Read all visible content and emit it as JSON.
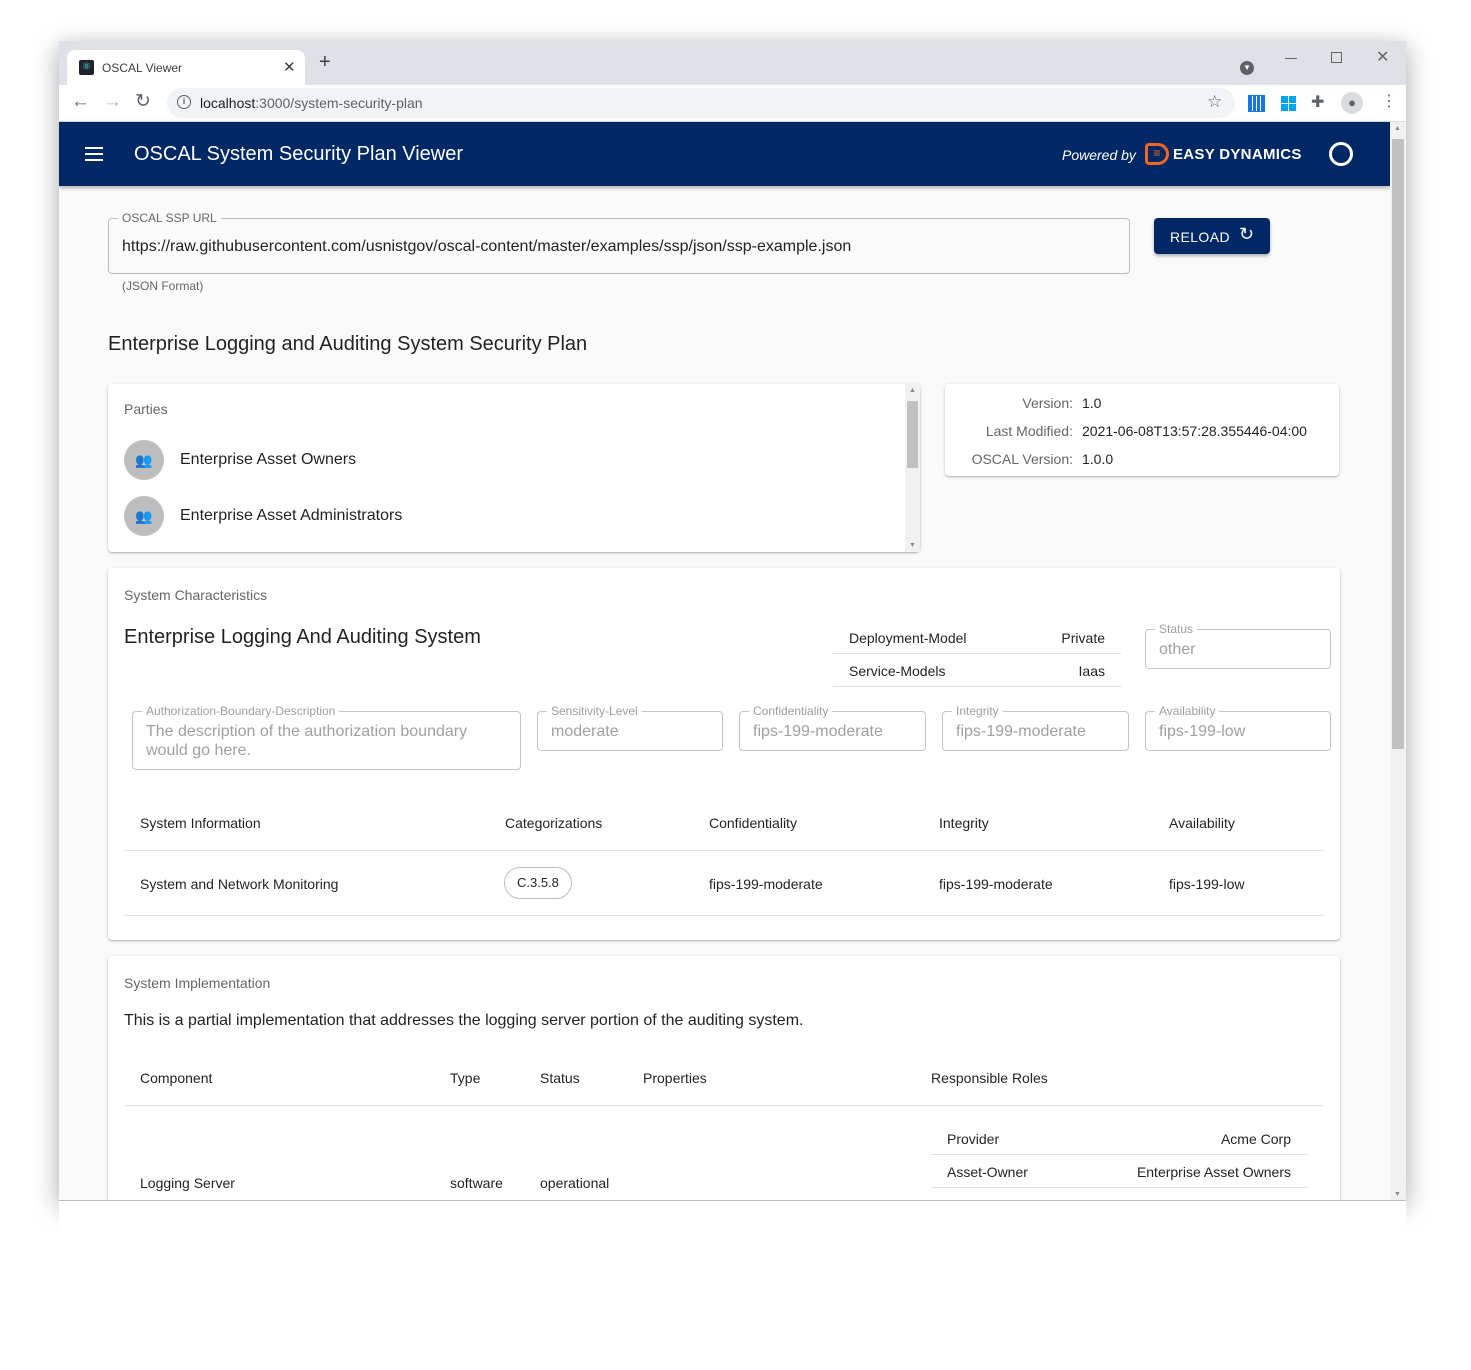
{
  "browser": {
    "tab_title": "OSCAL Viewer",
    "url_host": "localhost",
    "url_path": ":3000/system-security-plan"
  },
  "app": {
    "title": "OSCAL System Security Plan Viewer",
    "powered_by": "Powered by",
    "brand": "EASY DYNAMICS",
    "brand_color": "#f26722",
    "header_color": "#002864"
  },
  "url_field": {
    "label": "OSCAL SSP URL",
    "value": "https://raw.githubusercontent.com/usnistgov/oscal-content/master/examples/ssp/json/ssp-example.json",
    "helper": "(JSON Format)",
    "reload_label": "RELOAD"
  },
  "ssp_title": "Enterprise Logging and Auditing System Security Plan",
  "parties": {
    "heading": "Parties",
    "items": [
      "Enterprise Asset Owners",
      "Enterprise Asset Administrators"
    ]
  },
  "metadata": {
    "version_label": "Version:",
    "version": "1.0",
    "modified_label": "Last Modified:",
    "modified": "2021-06-08T13:57:28.355446-04:00",
    "oscal_label": "OSCAL Version:",
    "oscal": "1.0.0"
  },
  "characteristics": {
    "heading": "System Characteristics",
    "system_name": "Enterprise Logging And Auditing System",
    "props": [
      {
        "name": "Deployment-Model",
        "value": "Private"
      },
      {
        "name": "Service-Models",
        "value": "Iaas"
      }
    ],
    "status": {
      "label": "Status",
      "value": "other"
    },
    "auth_boundary": {
      "label": "Authorization-Boundary-Description",
      "value": "The description of the authorization boundary would go here."
    },
    "sensitivity": {
      "label": "Sensitivity-Level",
      "value": "moderate"
    },
    "confidentiality": {
      "label": "Confidentiality",
      "value": "fips-199-moderate"
    },
    "integrity": {
      "label": "Integrity",
      "value": "fips-199-moderate"
    },
    "availability": {
      "label": "Availability",
      "value": "fips-199-low"
    },
    "table": {
      "headers": [
        "System Information",
        "Categorizations",
        "Confidentiality",
        "Integrity",
        "Availability"
      ],
      "rows": [
        {
          "info": "System and Network Monitoring",
          "categorization": "C.3.5.8",
          "confidentiality": "fips-199-moderate",
          "integrity": "fips-199-moderate",
          "availability": "fips-199-low"
        }
      ]
    }
  },
  "implementation": {
    "heading": "System Implementation",
    "description": "This is a partial implementation that addresses the logging server portion of the auditing system.",
    "headers": [
      "Component",
      "Type",
      "Status",
      "Properties",
      "Responsible Roles"
    ],
    "rows": [
      {
        "component": "Logging Server",
        "type": "software",
        "status": "operational",
        "roles": [
          {
            "role": "Provider",
            "party": "Acme Corp"
          },
          {
            "role": "Asset-Owner",
            "party": "Enterprise Asset Owners"
          }
        ]
      }
    ]
  }
}
